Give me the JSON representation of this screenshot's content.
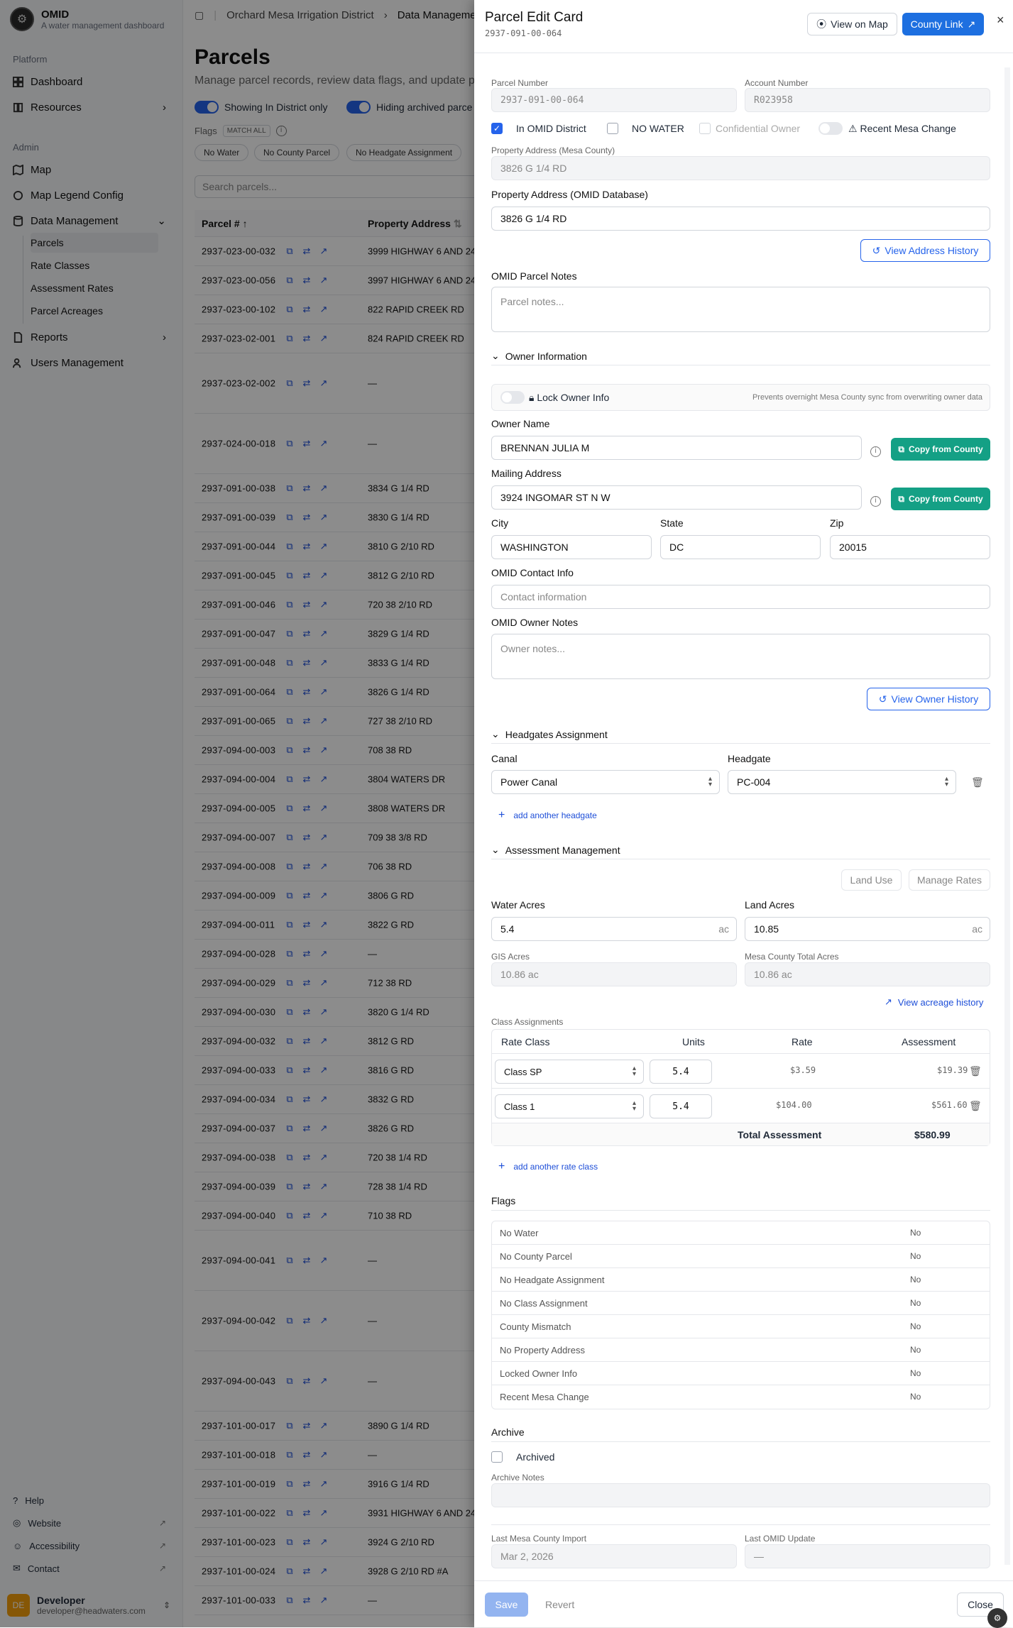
{
  "app": {
    "name": "OMID",
    "subtitle": "A water management dashboard"
  },
  "sidebar": {
    "platform_label": "Platform",
    "admin_label": "Admin",
    "items": {
      "dashboard": "Dashboard",
      "resources": "Resources",
      "map": "Map",
      "map_legend": "Map Legend Config",
      "data_mgmt": "Data Management",
      "reports": "Reports",
      "users": "Users Management"
    },
    "sub": {
      "parcels": "Parcels",
      "rate_classes": "Rate Classes",
      "assessment_rates": "Assessment Rates",
      "parcel_acreages": "Parcel Acreages"
    },
    "footer": {
      "help": "Help",
      "website": "Website",
      "accessibility": "Accessibility",
      "contact": "Contact"
    },
    "user": {
      "initials": "DE",
      "name": "Developer",
      "email": "developer@headwaters.com"
    }
  },
  "main": {
    "breadcrumb": [
      "Orchard Mesa Irrigation District",
      "Data Management"
    ],
    "title": "Parcels",
    "subtitle": "Manage parcel records, review data flags, and update p",
    "toggle1": "Showing In District only",
    "toggle2": "Hiding archived parce",
    "flags_label": "Flags",
    "match_all": "MATCH ALL",
    "chips": [
      "No Water",
      "No County Parcel",
      "No Headgate Assignment"
    ],
    "search_placeholder": "Search parcels...",
    "col_parcel": "Parcel #",
    "col_address": "Property Address",
    "rows": [
      {
        "p": "2937-023-00-032",
        "a": "3999 HIGHWAY 6 AND 24"
      },
      {
        "p": "2937-023-00-056",
        "a": "3997 HIGHWAY 6 AND 24"
      },
      {
        "p": "2937-023-00-102",
        "a": "822 RAPID CREEK RD"
      },
      {
        "p": "2937-023-02-001",
        "a": "824 RAPID CREEK RD"
      },
      {
        "p": "2937-023-02-002",
        "a": "—"
      },
      {
        "p": "2937-024-00-018",
        "a": "—"
      },
      {
        "p": "2937-091-00-038",
        "a": "3834 G 1/4 RD"
      },
      {
        "p": "2937-091-00-039",
        "a": "3830 G 1/4 RD"
      },
      {
        "p": "2937-091-00-044",
        "a": "3810 G 2/10 RD"
      },
      {
        "p": "2937-091-00-045",
        "a": "3812 G 2/10 RD"
      },
      {
        "p": "2937-091-00-046",
        "a": "720 38 2/10 RD"
      },
      {
        "p": "2937-091-00-047",
        "a": "3829 G 1/4 RD"
      },
      {
        "p": "2937-091-00-048",
        "a": "3833 G 1/4 RD"
      },
      {
        "p": "2937-091-00-064",
        "a": "3826 G 1/4 RD"
      },
      {
        "p": "2937-091-00-065",
        "a": "727 38 2/10 RD"
      },
      {
        "p": "2937-094-00-003",
        "a": "708 38 RD"
      },
      {
        "p": "2937-094-00-004",
        "a": "3804 WATERS DR"
      },
      {
        "p": "2937-094-00-005",
        "a": "3808 WATERS DR"
      },
      {
        "p": "2937-094-00-007",
        "a": "709 38 3/8 RD"
      },
      {
        "p": "2937-094-00-008",
        "a": "706 38 RD"
      },
      {
        "p": "2937-094-00-009",
        "a": "3806 G RD"
      },
      {
        "p": "2937-094-00-011",
        "a": "3822 G RD"
      },
      {
        "p": "2937-094-00-028",
        "a": "—"
      },
      {
        "p": "2937-094-00-029",
        "a": "712 38 RD"
      },
      {
        "p": "2937-094-00-030",
        "a": "3820 G 1/4 RD"
      },
      {
        "p": "2937-094-00-032",
        "a": "3812 G RD"
      },
      {
        "p": "2937-094-00-033",
        "a": "3816 G RD"
      },
      {
        "p": "2937-094-00-034",
        "a": "3832 G RD"
      },
      {
        "p": "2937-094-00-037",
        "a": "3826 G RD"
      },
      {
        "p": "2937-094-00-038",
        "a": "720 38 1/4 RD"
      },
      {
        "p": "2937-094-00-039",
        "a": "728 38 1/4 RD"
      },
      {
        "p": "2937-094-00-040",
        "a": "710 38 RD"
      },
      {
        "p": "2937-094-00-041",
        "a": "—"
      },
      {
        "p": "2937-094-00-042",
        "a": "—"
      },
      {
        "p": "2937-094-00-043",
        "a": "—"
      },
      {
        "p": "2937-101-00-017",
        "a": "3890 G 1/4 RD"
      },
      {
        "p": "2937-101-00-018",
        "a": "—"
      },
      {
        "p": "2937-101-00-019",
        "a": "3916 G 1/4 RD"
      },
      {
        "p": "2937-101-00-022",
        "a": "3931 HIGHWAY 6 AND 24"
      },
      {
        "p": "2937-101-00-023",
        "a": "3924 G 2/10 RD"
      },
      {
        "p": "2937-101-00-024",
        "a": "3928 G 2/10 RD #A"
      },
      {
        "p": "2937-101-00-033",
        "a": "—"
      }
    ]
  },
  "panel": {
    "title": "Parcel Edit Card",
    "parcel_id": "2937-091-00-064",
    "view_map": "View on Map",
    "county_link": "County Link",
    "parcel_number_label": "Parcel Number",
    "parcel_number": "2937-091-00-064",
    "account_number_label": "Account Number",
    "account_number": "R023958",
    "in_district": "In OMID District",
    "no_water": "NO WATER",
    "confidential": "Confidential Owner",
    "recent_change": "Recent Mesa Change",
    "addr_county_label": "Property Address (Mesa County)",
    "addr_county": "3826 G 1/4 RD",
    "addr_omid_label": "Property Address (OMID Database)",
    "addr_omid": "3826 G 1/4 RD",
    "view_addr_history": "View Address History",
    "parcel_notes_label": "OMID Parcel Notes",
    "parcel_notes_ph": "Parcel notes...",
    "owner_section": "Owner Information",
    "lock_owner": "Lock Owner Info",
    "lock_hint": "Prevents overnight Mesa County sync from overwriting owner data",
    "owner_name_label": "Owner Name",
    "owner_name": "BRENNAN JULIA M",
    "copy_county": "Copy from County",
    "mailing_label": "Mailing Address",
    "mailing": "3924 INGOMAR ST N W",
    "city_label": "City",
    "city": "WASHINGTON",
    "state_label": "State",
    "state": "DC",
    "zip_label": "Zip",
    "zip": "20015",
    "contact_label": "OMID Contact Info",
    "contact_ph": "Contact information",
    "owner_notes_label": "OMID Owner Notes",
    "owner_notes_ph": "Owner notes...",
    "view_owner_history": "View Owner History",
    "headgates_section": "Headgates Assignment",
    "canal_label": "Canal",
    "canal": "Power Canal",
    "headgate_label": "Headgate",
    "headgate": "PC-004",
    "add_headgate": "add another headgate",
    "assessment_section": "Assessment Management",
    "land_use": "Land Use",
    "manage_rates": "Manage Rates",
    "water_acres_label": "Water Acres",
    "water_acres": "5.4",
    "land_acres_label": "Land Acres",
    "land_acres": "10.85",
    "ac": "ac",
    "gis_label": "GIS Acres",
    "gis": "10.86 ac",
    "mesa_total_label": "Mesa County Total Acres",
    "mesa_total": "10.86 ac",
    "acreage_history": "View acreage history",
    "class_assign_label": "Class Assignments",
    "col_rate_class": "Rate Class",
    "col_units": "Units",
    "col_rate": "Rate",
    "col_assessment": "Assessment",
    "classes": [
      {
        "cls": "Class SP",
        "units": "5.4",
        "rate": "$3.59",
        "assess": "$19.39"
      },
      {
        "cls": "Class 1",
        "units": "5.4",
        "rate": "$104.00",
        "assess": "$561.60"
      }
    ],
    "total_label": "Total Assessment",
    "total": "$580.99",
    "add_rate_class": "add another rate class",
    "flags_label": "Flags",
    "flags": [
      {
        "name": "No Water",
        "val": "No"
      },
      {
        "name": "No County Parcel",
        "val": "No"
      },
      {
        "name": "No Headgate Assignment",
        "val": "No"
      },
      {
        "name": "No Class Assignment",
        "val": "No"
      },
      {
        "name": "County Mismatch",
        "val": "No"
      },
      {
        "name": "No Property Address",
        "val": "No"
      },
      {
        "name": "Locked Owner Info",
        "val": "No"
      },
      {
        "name": "Recent Mesa Change",
        "val": "No"
      }
    ],
    "archive_label": "Archive",
    "archived": "Archived",
    "archive_notes_label": "Archive Notes",
    "last_import_label": "Last Mesa County Import",
    "last_import": "Mar 2, 2026",
    "last_update_label": "Last OMID Update",
    "last_update": "—",
    "save": "Save",
    "revert": "Revert",
    "close": "Close"
  },
  "colors": {
    "accent": "#2563eb",
    "teal": "#14a085"
  }
}
